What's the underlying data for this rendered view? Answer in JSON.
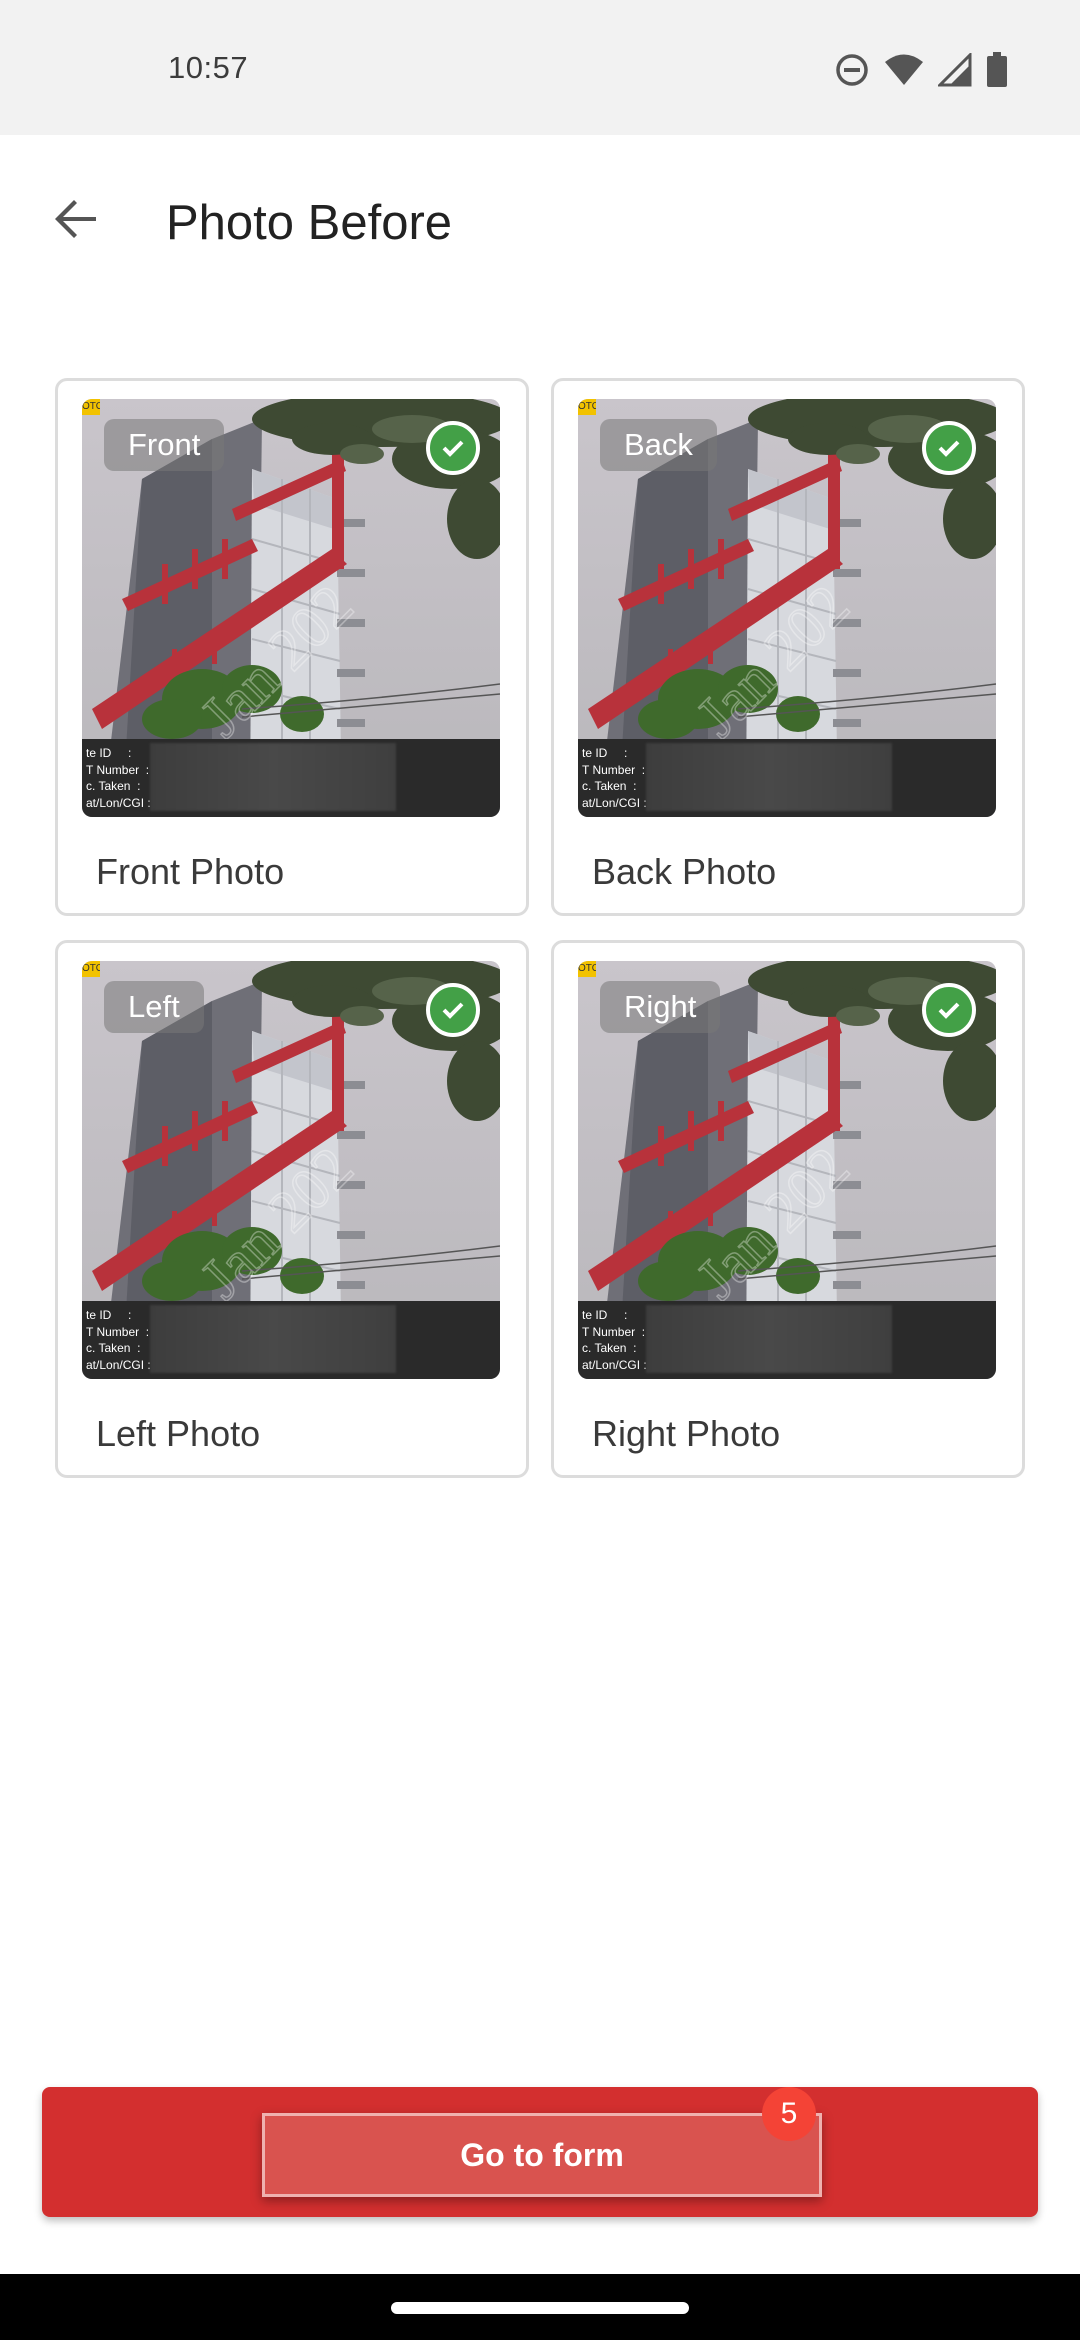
{
  "status_bar": {
    "time": "10:57",
    "icons": [
      "do-not-disturb-icon",
      "wifi-icon",
      "cell-signal-icon",
      "battery-icon"
    ]
  },
  "app_bar": {
    "back_icon": "arrow-back-icon",
    "title": "Photo Before"
  },
  "photos": [
    {
      "tag": "Front",
      "label": "Front Photo",
      "checked": true
    },
    {
      "tag": "Back",
      "label": "Back Photo",
      "checked": true
    },
    {
      "tag": "Left",
      "label": "Left Photo",
      "checked": true
    },
    {
      "tag": "Right",
      "label": "Right Photo",
      "checked": true
    }
  ],
  "photo_meta_labels": "te ID     :\nT Number  :\nc. Taken  :\nat/Lon/CGI :",
  "photo_ribbon": "OTO",
  "footer": {
    "button_label": "Go to form",
    "badge_count": "5"
  },
  "colors": {
    "primary": "#d32f2f",
    "check_green": "#43a047",
    "badge": "#f44336"
  }
}
